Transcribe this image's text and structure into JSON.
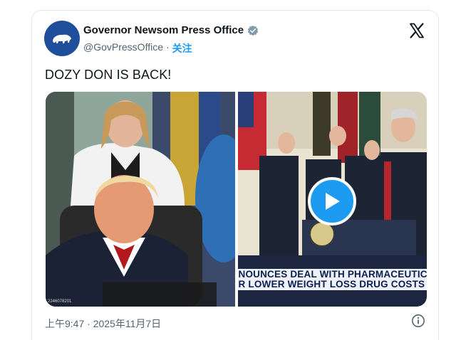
{
  "account": {
    "name": "Governor Newsom Press Office",
    "handle": "@GovPressOffice",
    "separator": "·",
    "follow_label": "关注"
  },
  "tweet": {
    "text": "DOZY DON IS BACK!",
    "timestamp": "上午9:47 · 2025年11月7日"
  },
  "media": {
    "left_image_caption": "2246078201",
    "video_ticker_line1": "NOUNCES DEAL WITH PHARMACEUTICAL",
    "video_ticker_line2": "R LOWER WEIGHT LOSS DRUG COSTS"
  },
  "colors": {
    "accent": "#1d9bf0",
    "avatar_bg": "#1f4f9a",
    "muted_text": "#536471"
  },
  "icons": [
    "verified-badge-icon",
    "x-logo-icon",
    "play-icon",
    "info-icon",
    "bear-icon"
  ]
}
